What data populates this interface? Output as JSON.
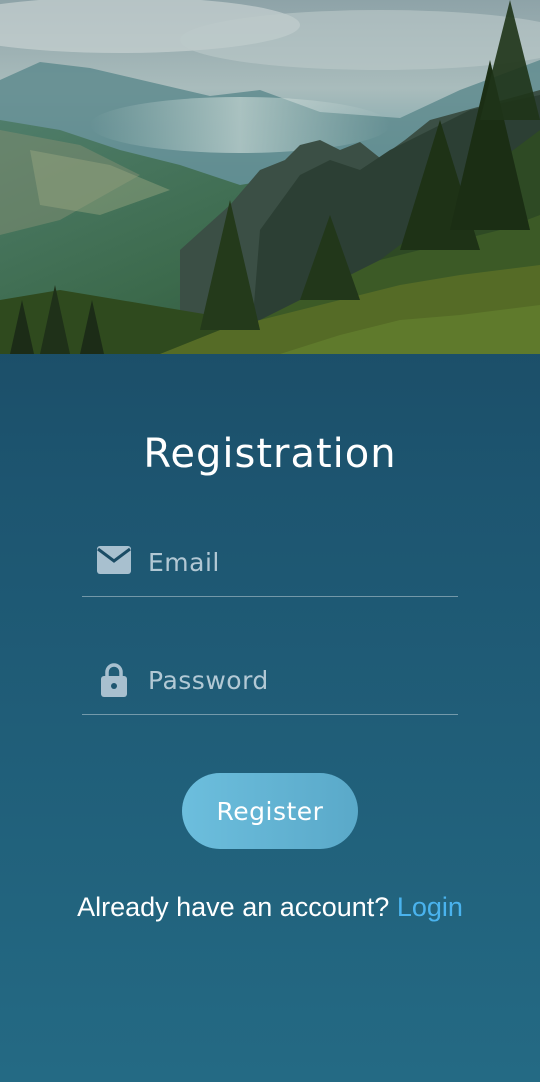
{
  "hero": {
    "image": "mountain-valley-landscape"
  },
  "form": {
    "title": "Registration",
    "email": {
      "icon": "envelope-icon",
      "placeholder": "Email",
      "value": ""
    },
    "password": {
      "icon": "lock-icon",
      "placeholder": "Password",
      "value": ""
    },
    "register_label": "Register",
    "footer_text": "Already have an account?",
    "login_label": "Login"
  },
  "colors": {
    "panel_top": "#173f57",
    "panel_bottom": "#246a84",
    "button": "#6cbedd",
    "link": "#4ab3ee"
  }
}
